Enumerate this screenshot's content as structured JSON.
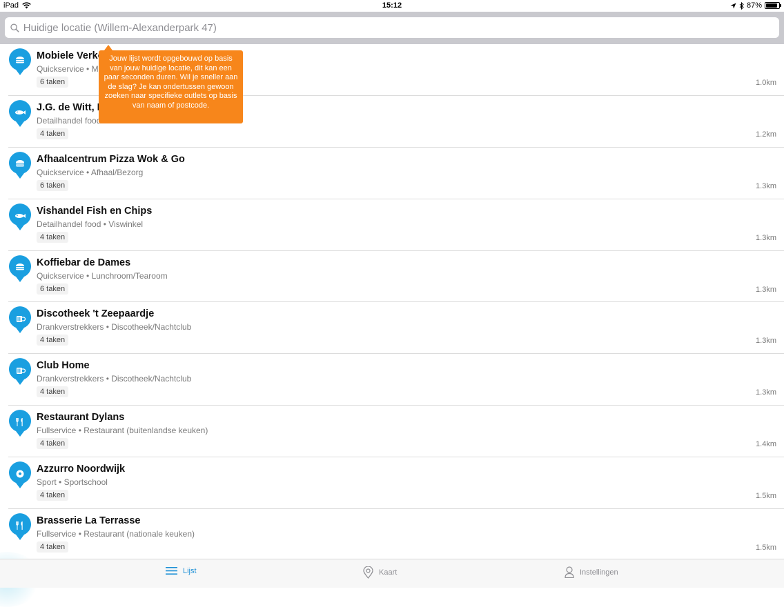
{
  "status_bar": {
    "device": "iPad",
    "time": "15:12",
    "battery": "87%",
    "battery_level": 0.87,
    "icons": [
      "wifi-icon",
      "location-arrow-icon",
      "bluetooth-icon",
      "battery-icon"
    ]
  },
  "search": {
    "placeholder": "Huidige locatie (Willem-Alexanderpark 47)",
    "value": ""
  },
  "tooltip": {
    "text": "Jouw lijst wordt opgebouwd op basis van jouw huidige locatie, dit kan een paar seconden duren. Wil je sneller aan de slag? Je kan ondertussen gewoon zoeken naar specifieke outlets op basis van naam of postcode."
  },
  "colors": {
    "accent": "#1e90d6",
    "pin": "#1a9fe0",
    "tooltip": "#f7861b"
  },
  "outlets": [
    {
      "name": "Mobiele Verko",
      "category": "Quickservice",
      "subcategory": "M",
      "tasks": "6 taken",
      "distance": "1.0km",
      "icon": "burger-icon"
    },
    {
      "name": "J.G. de Witt, D",
      "category": "Detailhandel food",
      "subcategory": "",
      "tasks": "4 taken",
      "distance": "1.2km",
      "icon": "fish-icon"
    },
    {
      "name": "Afhaalcentrum Pizza Wok & Go",
      "category": "Quickservice",
      "subcategory": "Afhaal/Bezorg",
      "tasks": "6 taken",
      "distance": "1.3km",
      "icon": "burger-icon"
    },
    {
      "name": "Vishandel Fish en Chips",
      "category": "Detailhandel food",
      "subcategory": "Viswinkel",
      "tasks": "4 taken",
      "distance": "1.3km",
      "icon": "fish-icon"
    },
    {
      "name": "Koffiebar de Dames",
      "category": "Quickservice",
      "subcategory": "Lunchroom/Tearoom",
      "tasks": "6 taken",
      "distance": "1.3km",
      "icon": "burger-icon"
    },
    {
      "name": "Discotheek 't Zeepaardje",
      "category": "Drankverstrekkers",
      "subcategory": "Discotheek/Nachtclub",
      "tasks": "4 taken",
      "distance": "1.3km",
      "icon": "beer-icon"
    },
    {
      "name": "Club Home",
      "category": "Drankverstrekkers",
      "subcategory": "Discotheek/Nachtclub",
      "tasks": "4 taken",
      "distance": "1.3km",
      "icon": "beer-icon"
    },
    {
      "name": "Restaurant Dylans",
      "category": "Fullservice",
      "subcategory": "Restaurant (buitenlandse keuken)",
      "tasks": "4 taken",
      "distance": "1.4km",
      "icon": "cutlery-icon"
    },
    {
      "name": "Azzurro Noordwijk",
      "category": "Sport",
      "subcategory": "Sportschool",
      "tasks": "4 taken",
      "distance": "1.5km",
      "icon": "soccer-ball-icon"
    },
    {
      "name": "Brasserie La Terrasse",
      "category": "Fullservice",
      "subcategory": "Restaurant (nationale keuken)",
      "tasks": "4 taken",
      "distance": "1.5km",
      "icon": "cutlery-icon"
    }
  ],
  "tabs": [
    {
      "label": "Lijst",
      "icon": "list-icon",
      "active": true
    },
    {
      "label": "Kaart",
      "icon": "map-pin-icon",
      "active": false
    },
    {
      "label": "Instellingen",
      "icon": "person-icon",
      "active": false
    }
  ]
}
